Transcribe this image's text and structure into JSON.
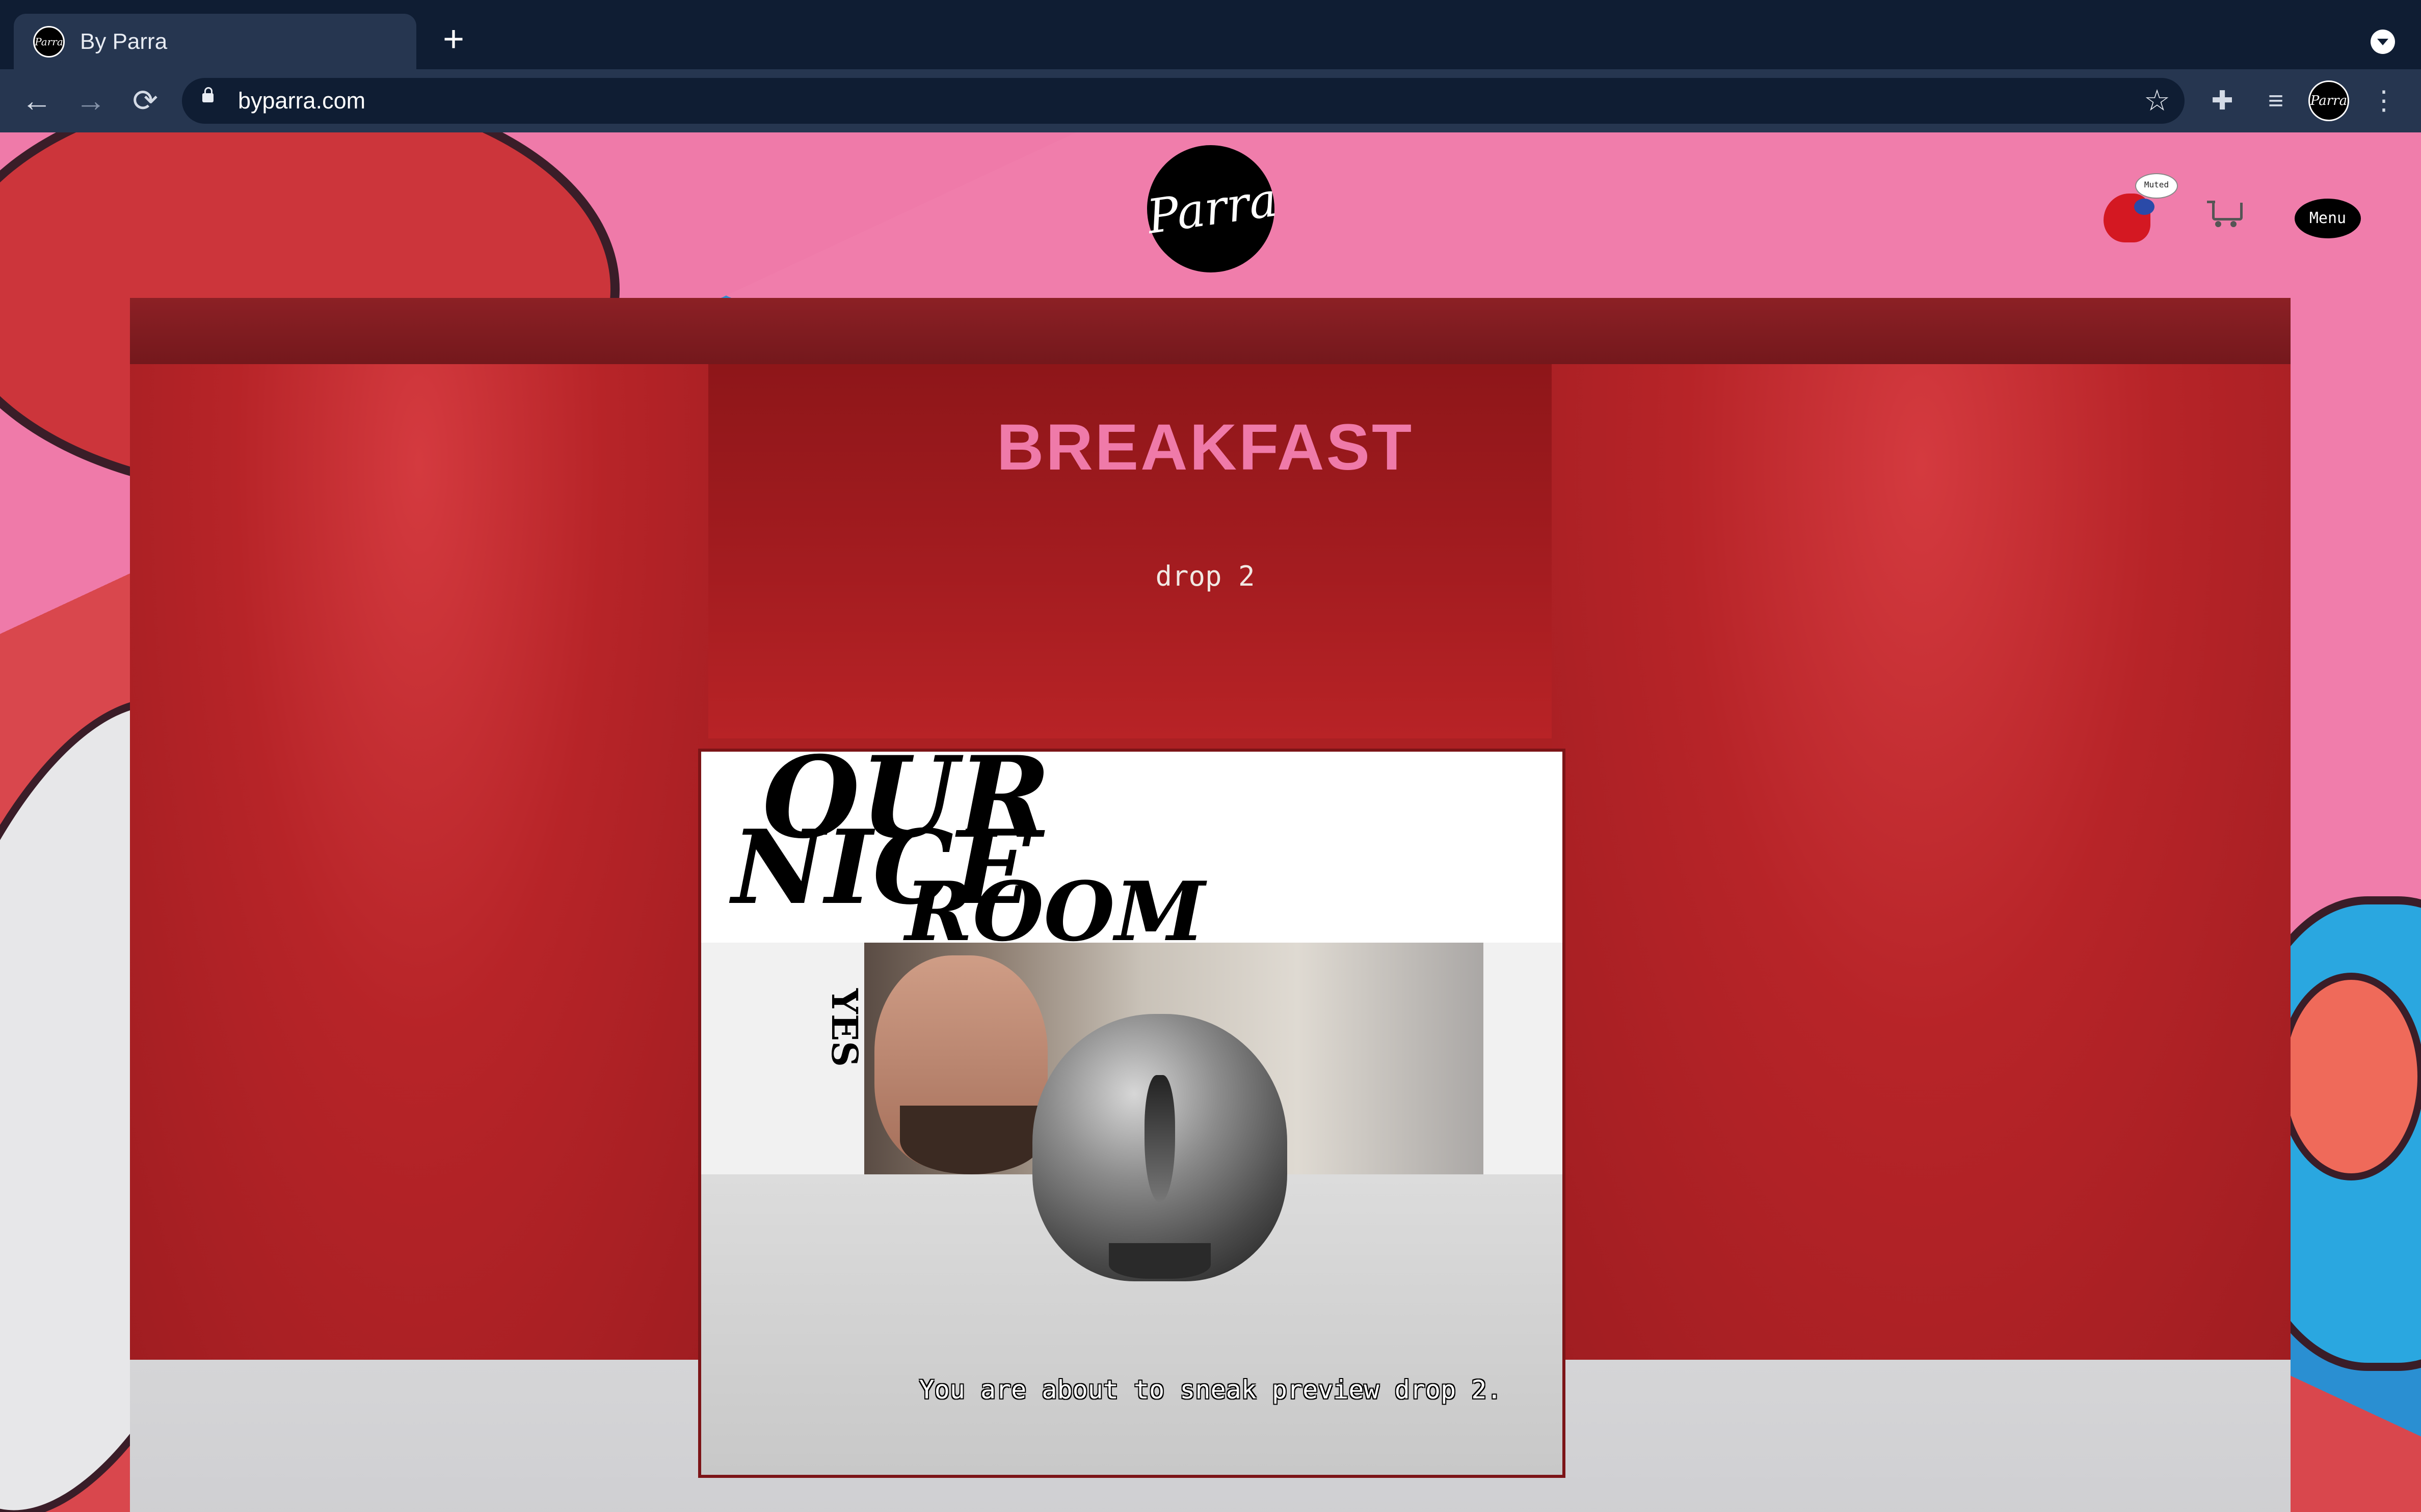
{
  "browser": {
    "tab": {
      "title": "By Parra",
      "favicon_text": "Parra"
    },
    "new_tab_label": "+",
    "url": "byparra.com",
    "nav": {
      "back": "←",
      "forward": "→",
      "reload": "⟳"
    },
    "toolbar_icons": {
      "extensions": "✚",
      "media": "≡",
      "more": "⋮",
      "bookmark": "☆"
    },
    "profile_text": "Parra"
  },
  "site": {
    "logo_text": "Parra",
    "sound_status": "Muted",
    "menu_label": "Menu"
  },
  "scene": {
    "title": "BREAKFAST",
    "subtitle": "drop 2",
    "ceiling_text": [
      "OUR",
      "NICE",
      "ROOM"
    ],
    "wall_text_left": "YES",
    "caption": "You are about to sneak preview drop 2."
  },
  "colors": {
    "accent_pink": "#ef7aa9",
    "stage_red": "#ab2023",
    "chrome_dark": "#0f1d33",
    "chrome_mid": "#263650"
  }
}
